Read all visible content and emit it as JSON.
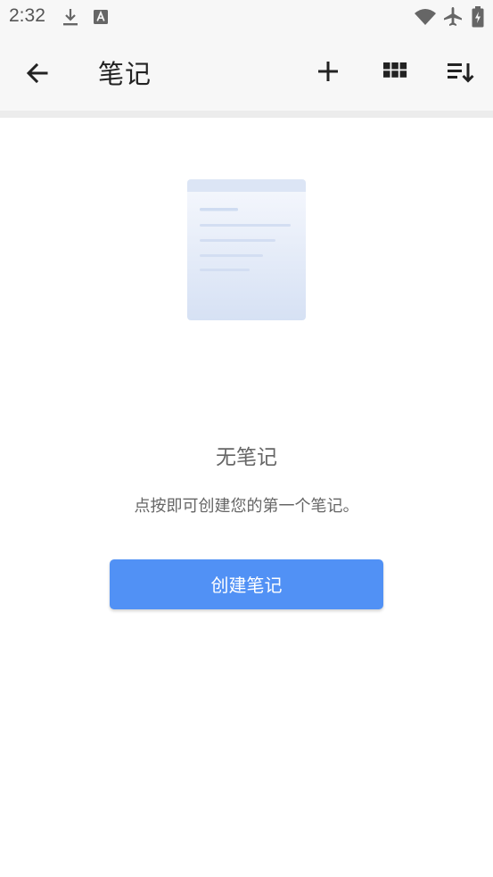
{
  "status_bar": {
    "time": "2:32",
    "icons": [
      "download-icon",
      "font-a-icon",
      "wifi-icon",
      "airplane-icon",
      "battery-icon"
    ]
  },
  "app_bar": {
    "title": "笔记",
    "actions": [
      "back-arrow-icon",
      "add-icon",
      "grid-view-icon",
      "sort-icon"
    ]
  },
  "empty_state": {
    "illustration": "document-icon",
    "title": "无笔记",
    "description": "点按即可创建您的第一个笔记。",
    "button_label": "创建笔记"
  },
  "colors": {
    "accent": "#5191f5",
    "bar_background": "#f7f7f7",
    "divider": "#ececec"
  }
}
